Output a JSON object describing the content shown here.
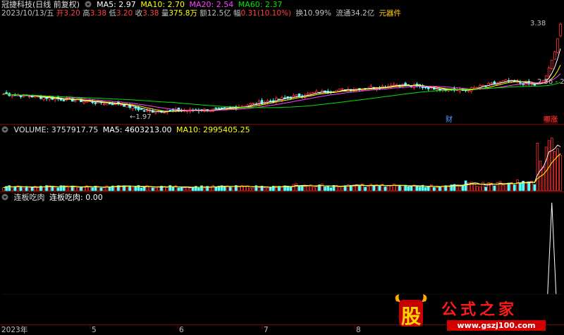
{
  "main_panel": {
    "stock_name": "冠捷科技(日线 前复权)",
    "indicators": [
      {
        "label": "MA5: 2.97",
        "color": "#ffffff"
      },
      {
        "label": "MA10: 2.70",
        "color": "#ffff00"
      },
      {
        "label": "MA20: 2.54",
        "color": "#ff40ff"
      },
      {
        "label": "MA60: 2.37",
        "color": "#00e600"
      }
    ]
  },
  "info_bar": {
    "date": "2023/10/13/五",
    "open_label": "开",
    "open": "3.20",
    "high_label": "高",
    "high": "3.38",
    "low_label": "低",
    "low": "3.20",
    "close_label": "收",
    "close": "3.38",
    "volume_label": "量",
    "volume": "375.8万",
    "amount_label": "额",
    "amount": "12.5亿",
    "change_label": "幅",
    "change": "0.31(10.10%)",
    "turnover_label": "换",
    "turnover": "10.99%",
    "float_label": "流通",
    "float_cap": "34.2亿",
    "device": "元器件"
  },
  "annotations": {
    "price_high": "3.38",
    "price_low": "1.97",
    "range_label": "2.56 - 2.",
    "tag_finance": "财",
    "tag_surge": "哪涨"
  },
  "volume_panel": {
    "title": "VOLUME: 3757917.75",
    "ma5": "MA5: 4603213.00",
    "ma10": "MA10: 2995405.25"
  },
  "indicator_panel": {
    "name": "连板吃肉",
    "value_line": "连板吃肉: 0.00"
  },
  "x_axis": {
    "labels": [
      "2023年",
      "5",
      "6",
      "7",
      "8"
    ]
  },
  "watermark": {
    "logo_char": "股",
    "site_name": "公式之家",
    "url": "www.gszj100.com"
  },
  "colors": {
    "up": "#ff3232",
    "down": "#54ffff",
    "ma5": "#ffffff",
    "ma10": "#ffff00",
    "ma20": "#ff40ff",
    "ma60": "#00e600",
    "separator": "#7a0000"
  },
  "chart_data": {
    "type": "candlestick",
    "series": [
      {
        "name": "MA5",
        "value": 2.97
      },
      {
        "name": "MA10",
        "value": 2.7
      },
      {
        "name": "MA20",
        "value": 2.54
      },
      {
        "name": "MA60",
        "value": 2.37
      }
    ],
    "price_range": [
      1.97,
      3.38
    ],
    "last_bar": {
      "date": "2023/10/13",
      "open": 3.2,
      "high": 3.38,
      "low": 3.2,
      "close": 3.38
    },
    "volume": {
      "last": 3757917.75,
      "ma5": 4603213.0,
      "ma10": 2995405.25
    },
    "indicator_last": 0.0,
    "x_ticks": [
      "2023年",
      "5",
      "6",
      "7",
      "8"
    ]
  }
}
